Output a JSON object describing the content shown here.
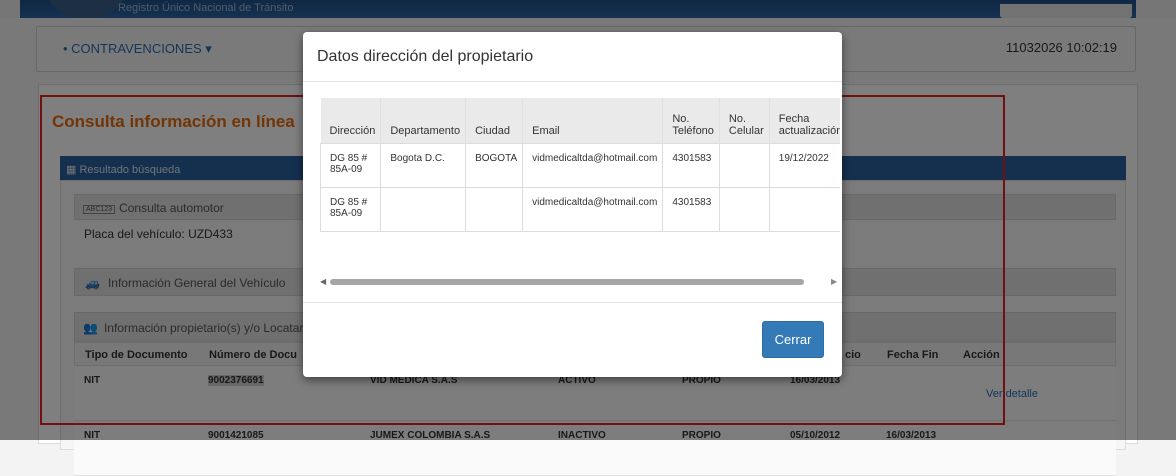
{
  "header": {
    "subtitle": "Registro Único Nacional de Tránsito"
  },
  "nav": {
    "menu_label": "• CONTRAVENCIONES ▾",
    "user_stamp": "11032026 10:02:19"
  },
  "page": {
    "title": "Consulta información en línea",
    "result_bar": "Resultado búsqueda",
    "section_vehicle": "Consulta automotor",
    "section_vehicle_badge": "ABC123",
    "plate_text": "Placa del vehículo: UZD433",
    "section_general": "Información General del Vehículo",
    "section_owners": "Información propietario(s) y/o Locatario(s)",
    "owners_table": {
      "headers": [
        "Tipo de Documento",
        "Número de Docu",
        "",
        "",
        "",
        "cio",
        "Fecha Fin",
        "Acción"
      ],
      "rows": [
        {
          "tipo": "NIT",
          "numero": "9002376691",
          "nombre": "VID MEDICA S.A.S",
          "estado": "ACTIVO",
          "tipo_prop": "PROPIO",
          "inicio": "16/03/2013",
          "fin": "",
          "accion": "Ver detalle"
        },
        {
          "tipo": "NIT",
          "numero": "9001421085",
          "nombre": "JUMEX COLOMBIA S.A.S",
          "estado": "INACTIVO",
          "tipo_prop": "PROPIO",
          "inicio": "05/10/2012",
          "fin": "16/03/2013",
          "accion": ""
        }
      ]
    }
  },
  "modal": {
    "title": "Datos dirección del propietario",
    "table": {
      "headers": [
        "Dirección",
        "Departamento",
        "Ciudad",
        "Email",
        "No. Teléfono",
        "No. Celular",
        "Fecha actualización"
      ],
      "rows": [
        [
          "DG 85 # 85A-09",
          "Bogota D.C.",
          "BOGOTA",
          "vidmedicaltda@hotmail.com",
          "4301583",
          "",
          "19/12/2022"
        ],
        [
          "DG 85 # 85A-09",
          "",
          "",
          "vidmedicaltda@hotmail.com",
          "4301583",
          "",
          ""
        ]
      ]
    },
    "close_label": "Cerrar"
  },
  "colors": {
    "accent_orange": "#e56a0c",
    "primary_blue": "#337ab7",
    "highlight_red": "#e3211c"
  }
}
